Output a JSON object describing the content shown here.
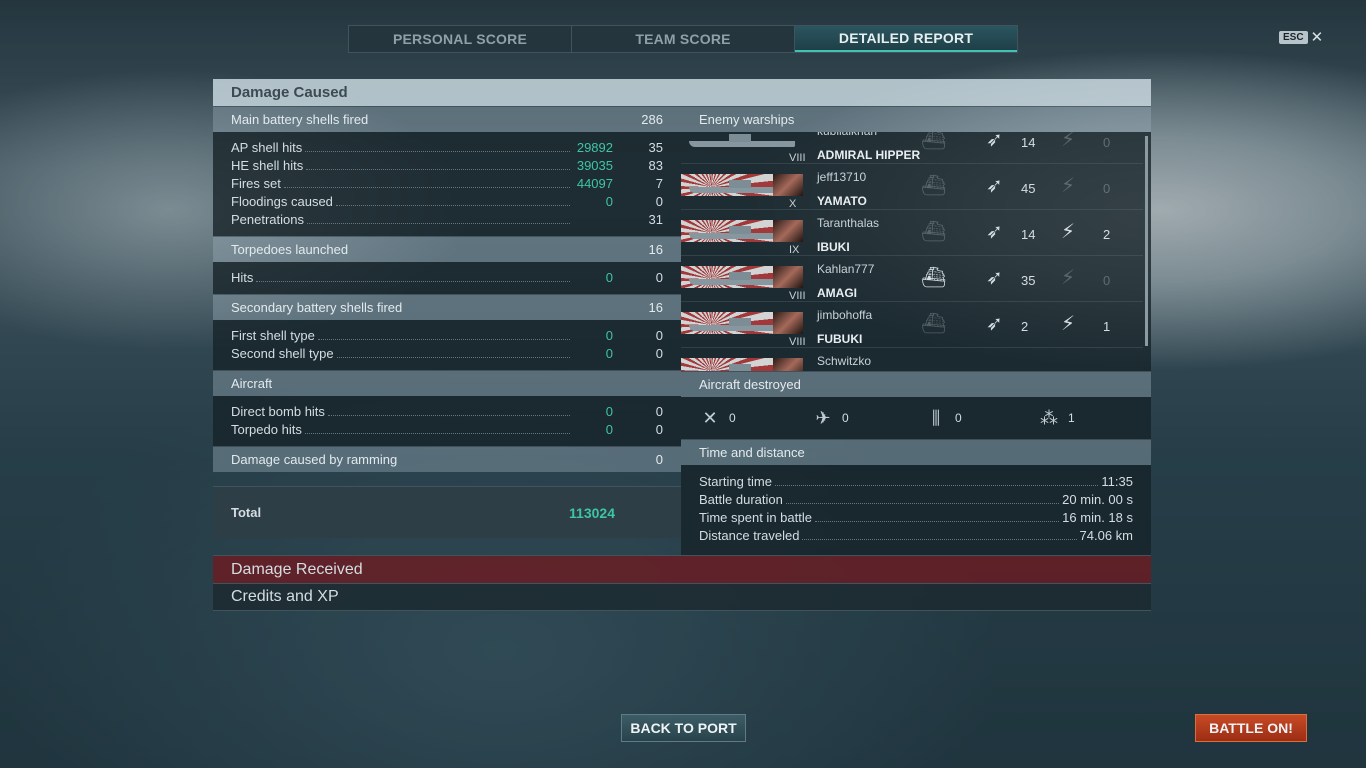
{
  "tabs": [
    {
      "label": "PERSONAL SCORE"
    },
    {
      "label": "TEAM SCORE"
    },
    {
      "label": "DETAILED REPORT"
    }
  ],
  "esc": {
    "key": "ESC",
    "close": "✕"
  },
  "damage_caused": {
    "title": "Damage Caused",
    "main_battery": {
      "label": "Main battery shells fired",
      "value": "286",
      "rows": [
        {
          "label": "AP shell hits",
          "damage": "29892",
          "count": "35"
        },
        {
          "label": "HE shell hits",
          "damage": "39035",
          "count": "83"
        },
        {
          "label": "Fires set",
          "damage": "44097",
          "count": "7"
        },
        {
          "label": "Floodings caused",
          "damage": "0",
          "count": "0"
        },
        {
          "label": "Penetrations",
          "damage": "",
          "count": "31"
        }
      ]
    },
    "torpedoes": {
      "label": "Torpedoes launched",
      "value": "16",
      "rows": [
        {
          "label": "Hits",
          "damage": "0",
          "count": "0"
        }
      ]
    },
    "secondary": {
      "label": "Secondary battery shells fired",
      "value": "16",
      "rows": [
        {
          "label": "First shell type",
          "damage": "0",
          "count": "0"
        },
        {
          "label": "Second shell type",
          "damage": "0",
          "count": "0"
        }
      ]
    },
    "aircraft": {
      "label": "Aircraft",
      "rows": [
        {
          "label": "Direct bomb hits",
          "damage": "0",
          "count": "0"
        },
        {
          "label": "Torpedo hits",
          "damage": "0",
          "count": "0"
        }
      ]
    },
    "ramming": {
      "label": "Damage caused by ramming",
      "value": "0"
    },
    "total": {
      "label": "Total",
      "value": "113024"
    }
  },
  "enemy_warships": {
    "title": "Enemy warships",
    "rows": [
      {
        "player": "kubilaikhan",
        "ship": "ADMIRAL HIPPER",
        "tier": "VIII",
        "hits": "14",
        "torps": "0"
      },
      {
        "player": "jeff13710",
        "ship": "YAMATO",
        "tier": "X",
        "hits": "45",
        "torps": "0"
      },
      {
        "player": "Taranthalas",
        "ship": "IBUKI",
        "tier": "IX",
        "hits": "14",
        "torps": "2"
      },
      {
        "player": "Kahlan777",
        "ship": "AMAGI",
        "tier": "VIII",
        "hits": "35",
        "torps": "0"
      },
      {
        "player": "jimbohoffa",
        "ship": "FUBUKI",
        "tier": "VIII",
        "hits": "2",
        "torps": "1"
      },
      {
        "player": "Schwitzko",
        "ship": "",
        "tier": "",
        "hits": "",
        "torps": ""
      }
    ]
  },
  "aircraft_destroyed": {
    "title": "Aircraft destroyed",
    "items": [
      {
        "icon": "fighter-icon",
        "value": "0"
      },
      {
        "icon": "bomber-icon",
        "value": "0"
      },
      {
        "icon": "torpedo-bomber-icon",
        "value": "0"
      },
      {
        "icon": "dive-bomber-icon",
        "value": "1"
      }
    ]
  },
  "time_distance": {
    "title": "Time and distance",
    "rows": [
      {
        "label": "Starting time",
        "value": "11:35"
      },
      {
        "label": "Battle duration",
        "value": "20 min. 00 s"
      },
      {
        "label": "Time spent in battle",
        "value": "16 min. 18 s"
      },
      {
        "label": "Distance traveled",
        "value": "74.06 km"
      }
    ]
  },
  "sections": {
    "damage_received": "Damage Received",
    "credits_xp": "Credits and XP"
  },
  "buttons": {
    "back": "BACK TO PORT",
    "battle": "BATTLE ON!"
  }
}
